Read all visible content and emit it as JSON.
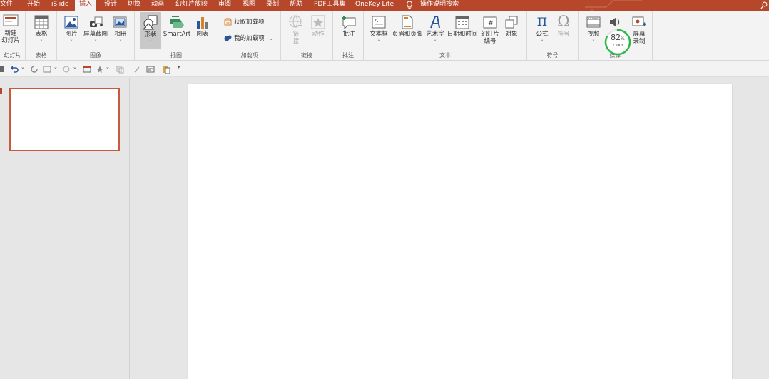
{
  "tabs": [
    {
      "label": "文件"
    },
    {
      "label": "开始"
    },
    {
      "label": "iSlide"
    },
    {
      "label": "插入",
      "active": true
    },
    {
      "label": "设计"
    },
    {
      "label": "切换"
    },
    {
      "label": "动画"
    },
    {
      "label": "幻灯片放映"
    },
    {
      "label": "审阅"
    },
    {
      "label": "视图"
    },
    {
      "label": "录制"
    },
    {
      "label": "帮助"
    },
    {
      "label": "PDF工具集"
    },
    {
      "label": "OneKey Lite"
    }
  ],
  "tell_me": "操作说明搜索",
  "ribbon": {
    "groups": {
      "slides": "幻灯片",
      "tables": "表格",
      "images": "图像",
      "illustrations": "插图",
      "addins": "加载项",
      "links": "链接",
      "comments": "批注",
      "text": "文本",
      "symbols": "符号",
      "media": "媒体"
    },
    "buttons": {
      "new_slide_line1": "新建",
      "new_slide_line2": "幻灯片",
      "table": "表格",
      "pictures": "图片",
      "screenshot": "屏幕截图",
      "album": "相册",
      "shapes": "形状",
      "smartart": "SmartArt",
      "chart": "图表",
      "get_addins": "获取加载项",
      "my_addins": "我的加载项",
      "link_line1": "链",
      "link_line2": "接",
      "action": "动作",
      "comment": "批注",
      "textbox": "文本框",
      "header_footer": "页眉和页脚",
      "wordart": "艺术字",
      "datetime": "日期和时间",
      "slide_number_line1": "幻灯片",
      "slide_number_line2": "编号",
      "object": "对象",
      "equation": "公式",
      "symbol": "符号",
      "video": "视频",
      "screen_record_line1": "屏幕",
      "screen_record_line2": "录制"
    }
  },
  "progress": {
    "percent_number": "82",
    "percent_sign": "%",
    "speed": "0K/s",
    "value": 0.82
  },
  "colors": {
    "accent": "#b7472a",
    "progress_ring": "#2db84d"
  }
}
